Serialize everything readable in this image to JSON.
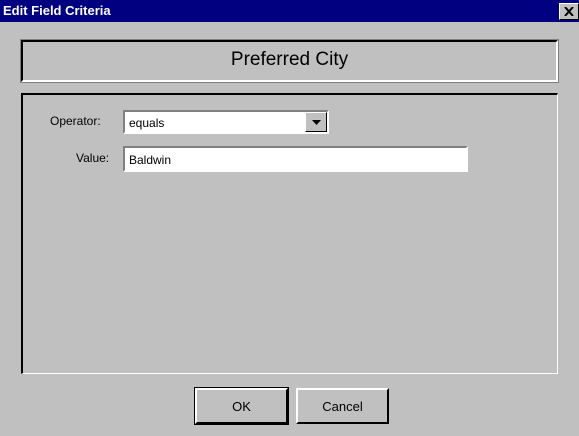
{
  "window": {
    "title": "Edit Field Criteria",
    "close_glyph": "✕"
  },
  "header": {
    "field_name": "Preferred City"
  },
  "form": {
    "operator_label": "Operator:",
    "operator_value": "equals",
    "value_label": "Value:",
    "value_value": "Baldwin"
  },
  "buttons": {
    "ok_label": "OK",
    "cancel_label": "Cancel"
  },
  "colors": {
    "titlebar": "#000080",
    "face": "#c0c0c0"
  }
}
